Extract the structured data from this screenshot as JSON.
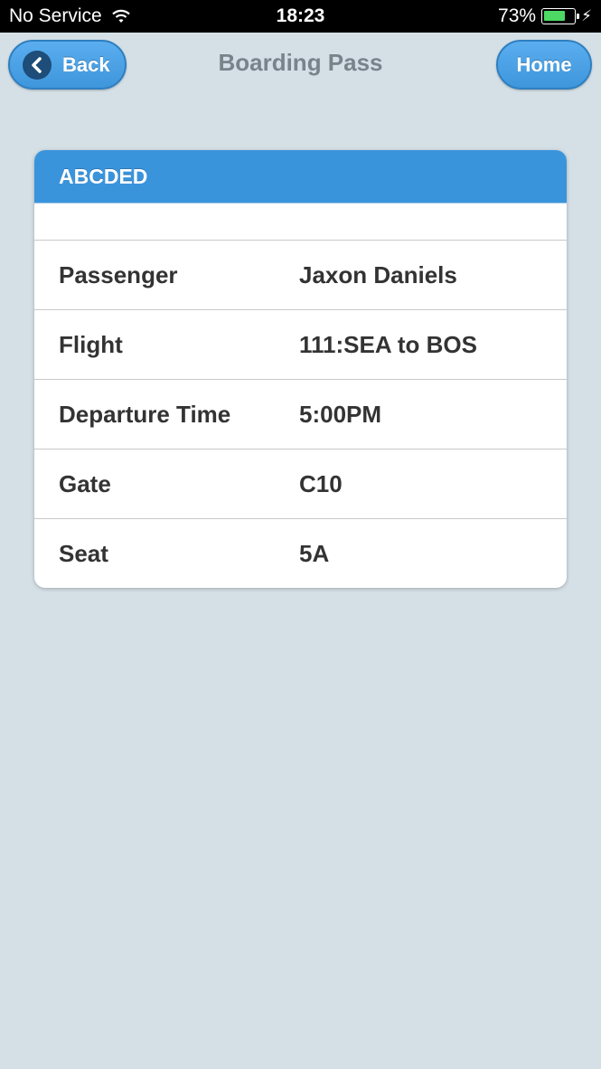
{
  "status_bar": {
    "carrier": "No Service",
    "time": "18:23",
    "battery_percent": "73%",
    "battery_level": 0.73,
    "battery_color": "#4cd964"
  },
  "nav": {
    "back_label": "Back",
    "title": "Boarding Pass",
    "home_label": "Home",
    "accent": "#3f96db"
  },
  "card": {
    "header": "ABCDED",
    "rows": [
      {
        "label": "Passenger",
        "value": "Jaxon Daniels"
      },
      {
        "label": "Flight",
        "value": "111:SEA to BOS"
      },
      {
        "label": "Departure Time",
        "value": "5:00PM"
      },
      {
        "label": "Gate",
        "value": "C10"
      },
      {
        "label": "Seat",
        "value": "5A"
      }
    ]
  }
}
